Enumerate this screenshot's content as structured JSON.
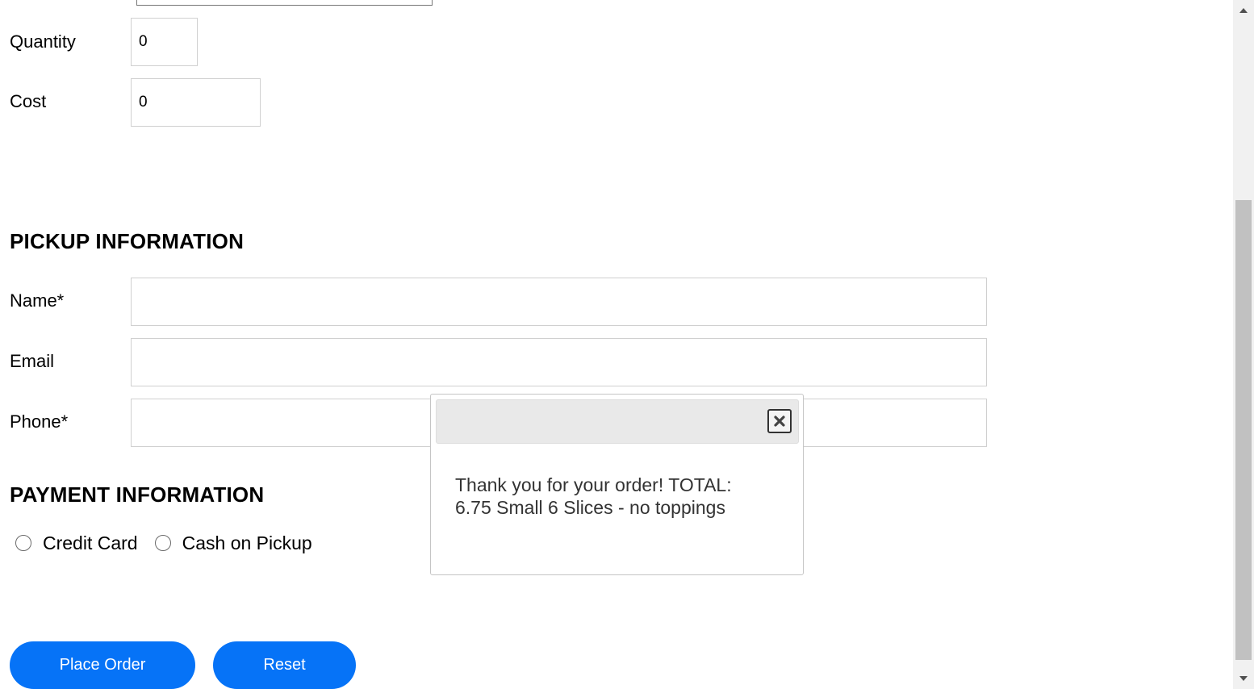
{
  "order": {
    "quantity_label": "Quantity",
    "quantity_value": "0",
    "cost_label": "Cost",
    "cost_value": "0"
  },
  "pickup": {
    "title": "PICKUP INFORMATION",
    "name_label": "Name*",
    "email_label": "Email",
    "phone_label": "Phone*"
  },
  "payment": {
    "title": "PAYMENT INFORMATION",
    "options": [
      "Credit Card",
      "Cash on Pickup"
    ]
  },
  "buttons": {
    "place_order": "Place Order",
    "reset": "Reset"
  },
  "dialog": {
    "message": "Thank you for your order! TOTAL: 6.75 Small 6 Slices - no toppings",
    "close_icon": "close-icon"
  },
  "colors": {
    "button_blue": "#0673f7",
    "dialog_titlebar": "#e9e9e9"
  }
}
